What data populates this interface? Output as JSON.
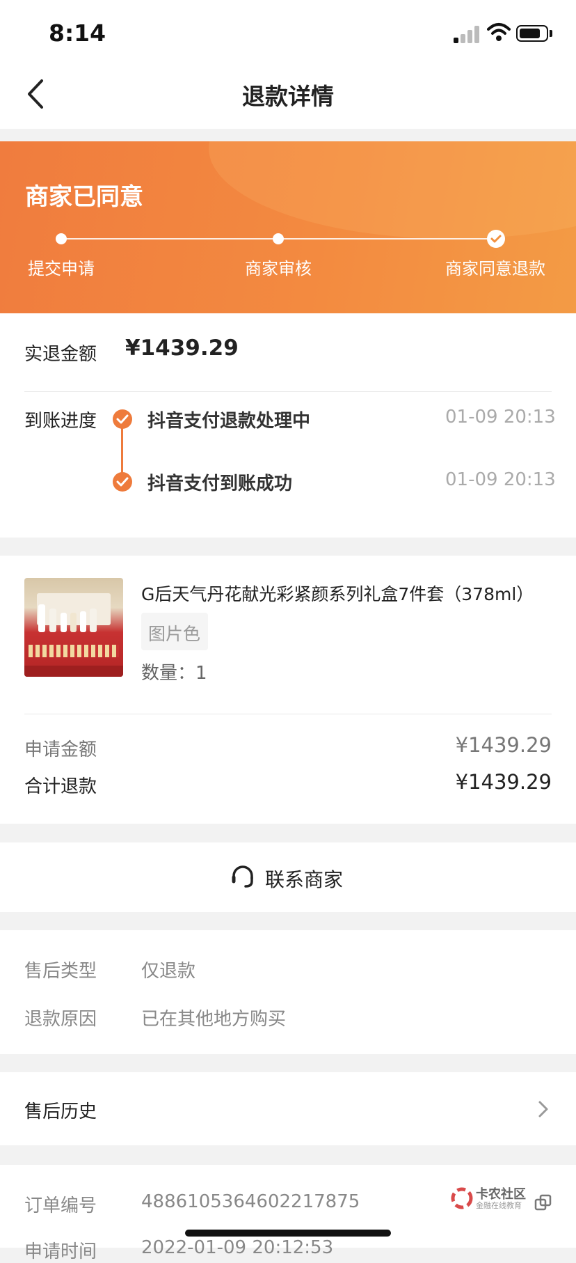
{
  "status_bar": {
    "time": "8:14"
  },
  "nav": {
    "title": "退款详情"
  },
  "banner": {
    "status": "商家已同意",
    "steps": [
      "提交申请",
      "商家审核",
      "商家同意退款"
    ]
  },
  "refund": {
    "amount_label": "实退金额",
    "amount": "¥1439.29",
    "progress_label": "到账进度",
    "timeline": [
      {
        "text": "抖音支付退款处理中",
        "time": "01-09 20:13"
      },
      {
        "text": "抖音支付到账成功",
        "time": "01-09 20:13"
      }
    ]
  },
  "product": {
    "name": "G后天气丹花献光彩紧颜系列礼盒7件套（378ml）",
    "spec": "图片色",
    "quantity": "数量：1",
    "apply_label": "申请金额",
    "apply_amount": "¥1439.29",
    "total_label": "合计退款",
    "total_amount": "¥1439.29"
  },
  "contact": {
    "label": "联系商家"
  },
  "aftersale": {
    "type_label": "售后类型",
    "type_value": "仅退款",
    "reason_label": "退款原因",
    "reason_value": "已在其他地方购买"
  },
  "history": {
    "label": "售后历史"
  },
  "order": {
    "number_label": "订单编号",
    "number_value": "4886105364602217875",
    "apply_time_label": "申请时间",
    "apply_time_value": "2022-01-09 20:12:53"
  },
  "watermark": {
    "text": "卡农社区",
    "sub": "金融在线教育"
  },
  "colors": {
    "accent": "#ee7b3c",
    "banner_start": "#f07c3e",
    "banner_end": "#f39b45"
  }
}
